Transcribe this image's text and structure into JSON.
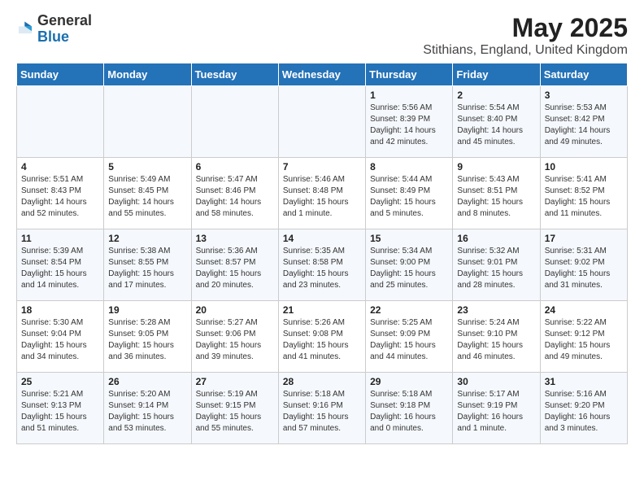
{
  "logo": {
    "general": "General",
    "blue": "Blue"
  },
  "title": "May 2025",
  "subtitle": "Stithians, England, United Kingdom",
  "days": [
    "Sunday",
    "Monday",
    "Tuesday",
    "Wednesday",
    "Thursday",
    "Friday",
    "Saturday"
  ],
  "weeks": [
    [
      {
        "day": "",
        "content": ""
      },
      {
        "day": "",
        "content": ""
      },
      {
        "day": "",
        "content": ""
      },
      {
        "day": "",
        "content": ""
      },
      {
        "day": "1",
        "content": "Sunrise: 5:56 AM\nSunset: 8:39 PM\nDaylight: 14 hours\nand 42 minutes."
      },
      {
        "day": "2",
        "content": "Sunrise: 5:54 AM\nSunset: 8:40 PM\nDaylight: 14 hours\nand 45 minutes."
      },
      {
        "day": "3",
        "content": "Sunrise: 5:53 AM\nSunset: 8:42 PM\nDaylight: 14 hours\nand 49 minutes."
      }
    ],
    [
      {
        "day": "4",
        "content": "Sunrise: 5:51 AM\nSunset: 8:43 PM\nDaylight: 14 hours\nand 52 minutes."
      },
      {
        "day": "5",
        "content": "Sunrise: 5:49 AM\nSunset: 8:45 PM\nDaylight: 14 hours\nand 55 minutes."
      },
      {
        "day": "6",
        "content": "Sunrise: 5:47 AM\nSunset: 8:46 PM\nDaylight: 14 hours\nand 58 minutes."
      },
      {
        "day": "7",
        "content": "Sunrise: 5:46 AM\nSunset: 8:48 PM\nDaylight: 15 hours\nand 1 minute."
      },
      {
        "day": "8",
        "content": "Sunrise: 5:44 AM\nSunset: 8:49 PM\nDaylight: 15 hours\nand 5 minutes."
      },
      {
        "day": "9",
        "content": "Sunrise: 5:43 AM\nSunset: 8:51 PM\nDaylight: 15 hours\nand 8 minutes."
      },
      {
        "day": "10",
        "content": "Sunrise: 5:41 AM\nSunset: 8:52 PM\nDaylight: 15 hours\nand 11 minutes."
      }
    ],
    [
      {
        "day": "11",
        "content": "Sunrise: 5:39 AM\nSunset: 8:54 PM\nDaylight: 15 hours\nand 14 minutes."
      },
      {
        "day": "12",
        "content": "Sunrise: 5:38 AM\nSunset: 8:55 PM\nDaylight: 15 hours\nand 17 minutes."
      },
      {
        "day": "13",
        "content": "Sunrise: 5:36 AM\nSunset: 8:57 PM\nDaylight: 15 hours\nand 20 minutes."
      },
      {
        "day": "14",
        "content": "Sunrise: 5:35 AM\nSunset: 8:58 PM\nDaylight: 15 hours\nand 23 minutes."
      },
      {
        "day": "15",
        "content": "Sunrise: 5:34 AM\nSunset: 9:00 PM\nDaylight: 15 hours\nand 25 minutes."
      },
      {
        "day": "16",
        "content": "Sunrise: 5:32 AM\nSunset: 9:01 PM\nDaylight: 15 hours\nand 28 minutes."
      },
      {
        "day": "17",
        "content": "Sunrise: 5:31 AM\nSunset: 9:02 PM\nDaylight: 15 hours\nand 31 minutes."
      }
    ],
    [
      {
        "day": "18",
        "content": "Sunrise: 5:30 AM\nSunset: 9:04 PM\nDaylight: 15 hours\nand 34 minutes."
      },
      {
        "day": "19",
        "content": "Sunrise: 5:28 AM\nSunset: 9:05 PM\nDaylight: 15 hours\nand 36 minutes."
      },
      {
        "day": "20",
        "content": "Sunrise: 5:27 AM\nSunset: 9:06 PM\nDaylight: 15 hours\nand 39 minutes."
      },
      {
        "day": "21",
        "content": "Sunrise: 5:26 AM\nSunset: 9:08 PM\nDaylight: 15 hours\nand 41 minutes."
      },
      {
        "day": "22",
        "content": "Sunrise: 5:25 AM\nSunset: 9:09 PM\nDaylight: 15 hours\nand 44 minutes."
      },
      {
        "day": "23",
        "content": "Sunrise: 5:24 AM\nSunset: 9:10 PM\nDaylight: 15 hours\nand 46 minutes."
      },
      {
        "day": "24",
        "content": "Sunrise: 5:22 AM\nSunset: 9:12 PM\nDaylight: 15 hours\nand 49 minutes."
      }
    ],
    [
      {
        "day": "25",
        "content": "Sunrise: 5:21 AM\nSunset: 9:13 PM\nDaylight: 15 hours\nand 51 minutes."
      },
      {
        "day": "26",
        "content": "Sunrise: 5:20 AM\nSunset: 9:14 PM\nDaylight: 15 hours\nand 53 minutes."
      },
      {
        "day": "27",
        "content": "Sunrise: 5:19 AM\nSunset: 9:15 PM\nDaylight: 15 hours\nand 55 minutes."
      },
      {
        "day": "28",
        "content": "Sunrise: 5:18 AM\nSunset: 9:16 PM\nDaylight: 15 hours\nand 57 minutes."
      },
      {
        "day": "29",
        "content": "Sunrise: 5:18 AM\nSunset: 9:18 PM\nDaylight: 16 hours\nand 0 minutes."
      },
      {
        "day": "30",
        "content": "Sunrise: 5:17 AM\nSunset: 9:19 PM\nDaylight: 16 hours\nand 1 minute."
      },
      {
        "day": "31",
        "content": "Sunrise: 5:16 AM\nSunset: 9:20 PM\nDaylight: 16 hours\nand 3 minutes."
      }
    ]
  ]
}
